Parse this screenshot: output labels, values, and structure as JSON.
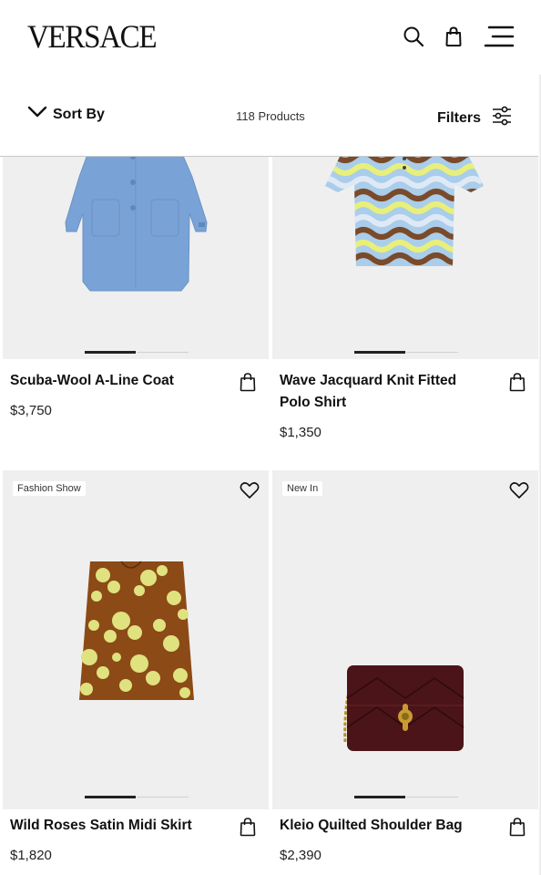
{
  "header": {
    "logo": "VERSACE",
    "icons": [
      "search-icon",
      "shopping-bag-icon",
      "menu-icon"
    ]
  },
  "toolbar": {
    "sort_label": "Sort By",
    "product_count": "118 Products",
    "filters_label": "Filters"
  },
  "products": [
    {
      "name": "Scuba-Wool A-Line Coat",
      "price": "$3,750",
      "badge": ""
    },
    {
      "name": "Wave Jacquard Knit Fitted Polo Shirt",
      "price": "$1,350",
      "badge": ""
    },
    {
      "name": "Wild Roses Satin Midi Skirt",
      "price": "$1,820",
      "badge": "Fashion Show"
    },
    {
      "name": "Kleio Quilted Shoulder Bag",
      "price": "$2,390",
      "badge": "New In"
    }
  ]
}
